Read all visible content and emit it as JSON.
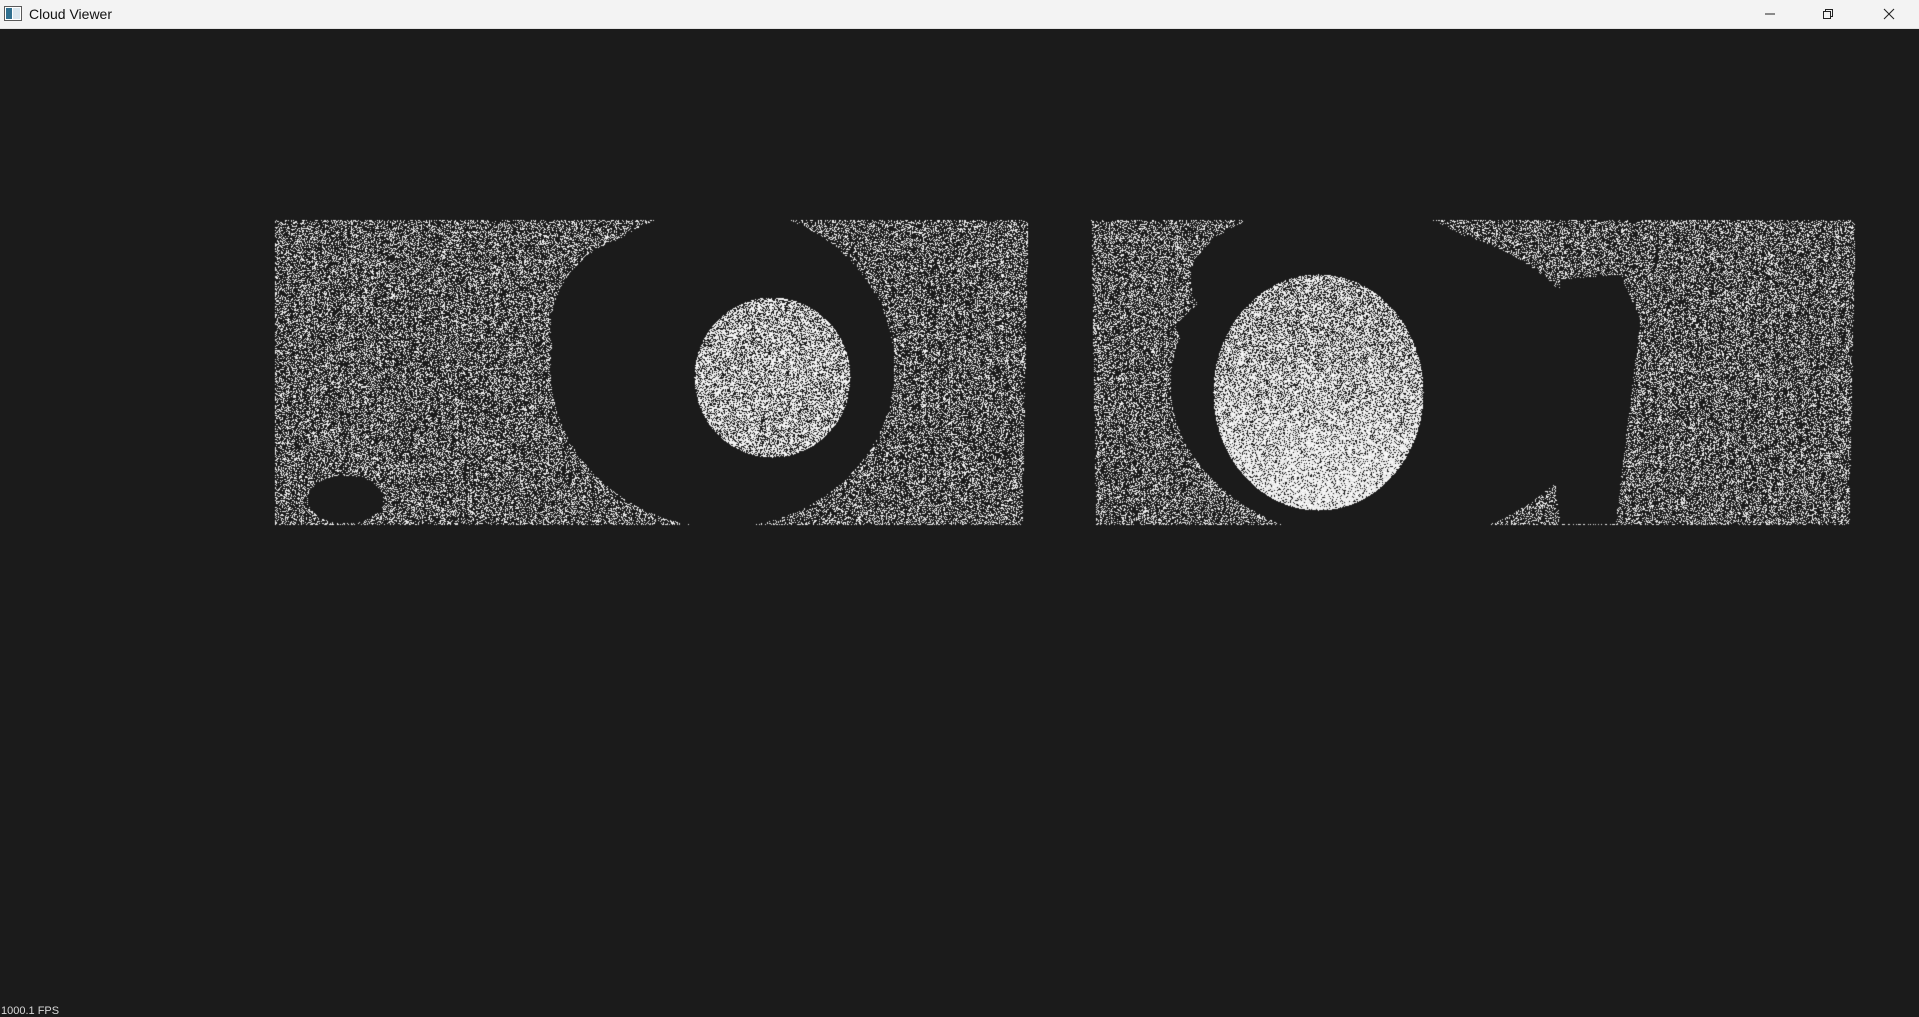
{
  "window": {
    "title": "Cloud Viewer",
    "icon": "app-window-icon",
    "controls": {
      "minimize": "minimize-icon",
      "restore": "restore-icon",
      "close": "close-icon"
    }
  },
  "viewport": {
    "background_color": "#1b1b1b",
    "point_color": "#ffffff"
  },
  "status": {
    "fps_text": "1000.1 FPS"
  }
}
